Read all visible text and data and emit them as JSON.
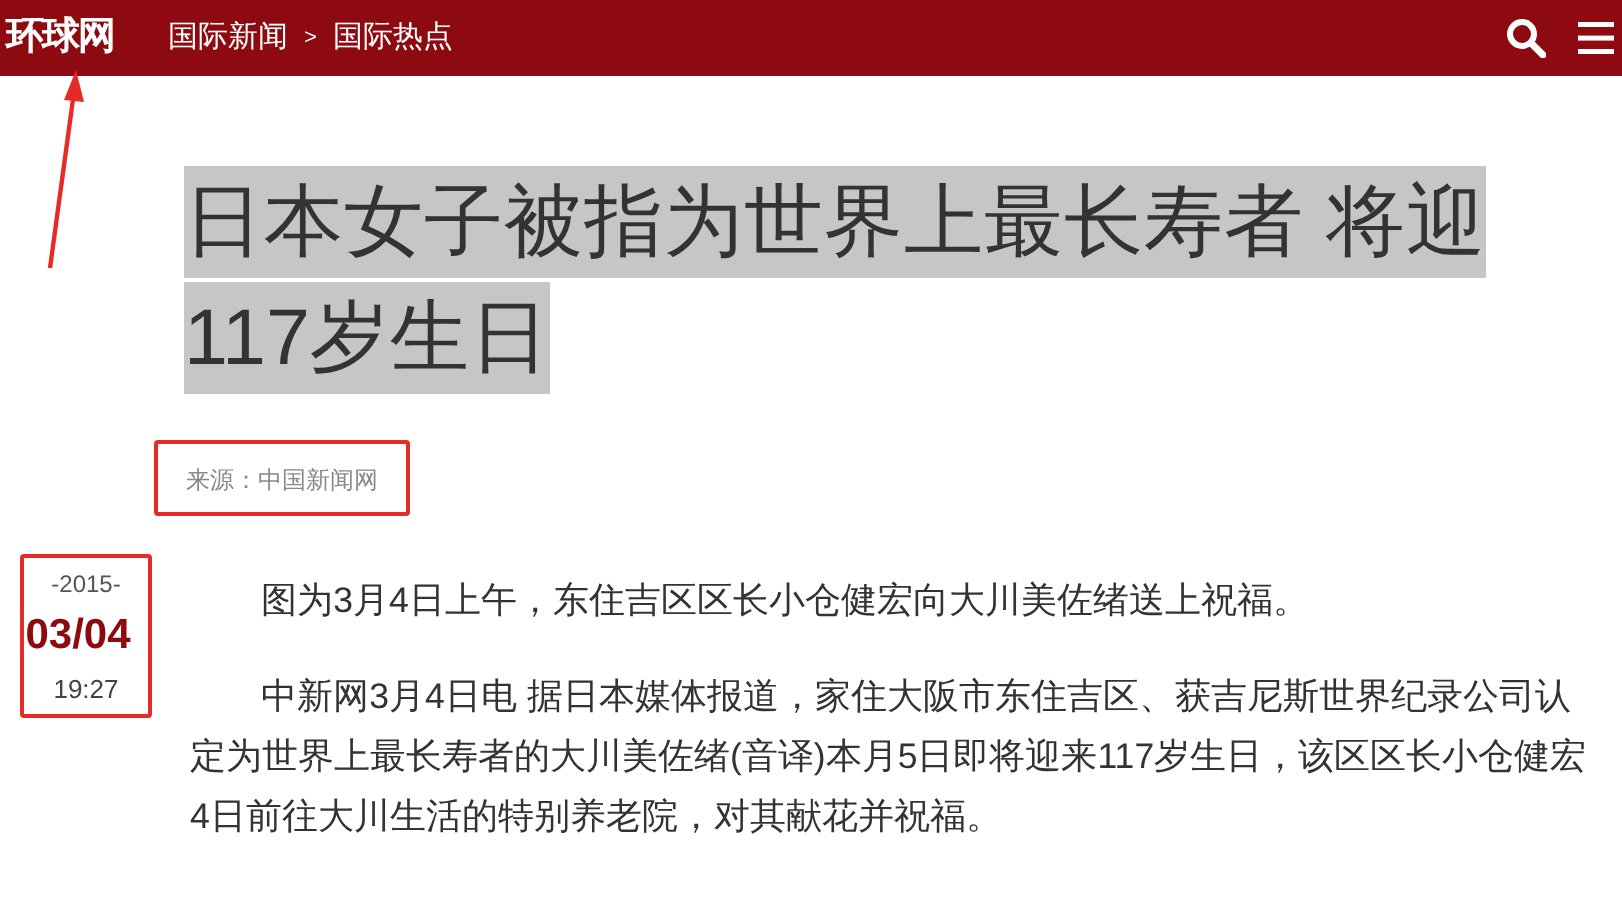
{
  "header": {
    "logo": "环球网",
    "logo_annotated": true,
    "breadcrumb": [
      {
        "label": "国际新闻"
      },
      {
        "label": ">",
        "kind": "separator"
      },
      {
        "label": "国际热点"
      }
    ]
  },
  "article": {
    "title": "日本女子被指为世界上最长寿者 将迎117岁生日",
    "title_selected": true,
    "source": "来源：中国新闻网",
    "source_annotated": true,
    "date": {
      "year": "-2015-",
      "day": "03/04",
      "time": "19:27",
      "annotated": true
    },
    "paragraphs": [
      "图为3月4日上午，东住吉区区长小仓健宏向大川美佐绪送上祝福。",
      "中新网3月4日电 据日本媒体报道，家住大阪市东住吉区、获吉尼斯世界纪录公司认定为世界上最长寿者的大川美佐绪(音译)本月5日即将迎来117岁生日，该区区长小仓健宏4日前往大川生活的特别养老院，对其献花并祝福。"
    ]
  }
}
